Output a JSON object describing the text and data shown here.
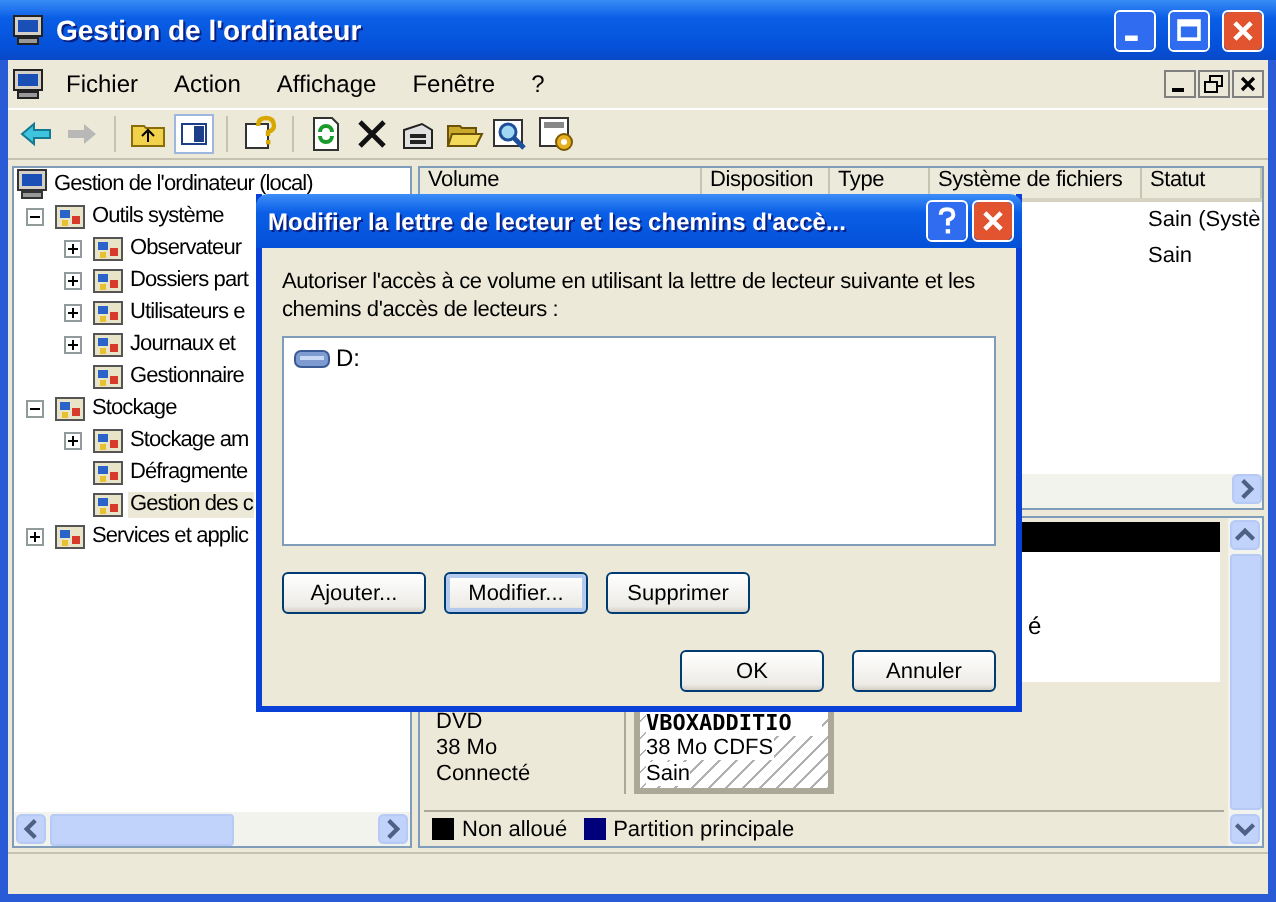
{
  "window": {
    "title": "Gestion de l'ordinateur"
  },
  "menu": [
    "Fichier",
    "Action",
    "Affichage",
    "Fenêtre",
    "?"
  ],
  "tree": {
    "label": "Gestion de l'ordinateur (local)",
    "selected": false,
    "children": [
      {
        "label": "Outils système",
        "expanded": true,
        "selected": false,
        "children": [
          {
            "label": "Observateur",
            "expanded": false,
            "selected": false
          },
          {
            "label": "Dossiers part",
            "expanded": false,
            "selected": false
          },
          {
            "label": "Utilisateurs e",
            "expanded": false,
            "selected": false
          },
          {
            "label": "Journaux et",
            "expanded": false,
            "selected": false
          },
          {
            "label": "Gestionnaire",
            "selected": false
          }
        ]
      },
      {
        "label": "Stockage",
        "expanded": true,
        "selected": false,
        "children": [
          {
            "label": "Stockage am",
            "expanded": false,
            "selected": false
          },
          {
            "label": "Défragmente",
            "selected": false
          },
          {
            "label": "Gestion des c",
            "selected": true
          }
        ]
      },
      {
        "label": "Services et applic",
        "expanded": false,
        "selected": false
      }
    ]
  },
  "volume_list": {
    "columns": [
      "Volume",
      "Disposition",
      "Type",
      "Système de fichiers",
      "Statut"
    ],
    "rows": [
      {
        "statut": "Sain (Systè"
      },
      {
        "statut": "Sain"
      }
    ]
  },
  "disk_view": {
    "disk_0": {
      "volume_text": "é"
    },
    "disk_1": {
      "labels": [
        "DVD",
        "38 Mo",
        "Connecté"
      ],
      "volume_name": "VBOXADDITIO",
      "volume_details": [
        "38 Mo CDFS",
        "Sain"
      ]
    },
    "legend": [
      {
        "label": "Non alloué",
        "color": "#000000"
      },
      {
        "label": "Partition principale",
        "color": "#00007b"
      }
    ]
  },
  "dialog": {
    "title": "Modifier la lettre de lecteur et les chemins d'accè...",
    "text": "Autoriser l'accès à ce volume en utilisant la lettre de lecteur suivante et les chemins d'accès de lecteurs :",
    "paths": [
      {
        "label": "D:",
        "selected": false
      }
    ],
    "buttons": [
      {
        "label": "Ajouter...",
        "focused": false
      },
      {
        "label": "Modifier...",
        "focused": true
      },
      {
        "label": "Supprimer",
        "focused": false
      }
    ],
    "footer_buttons": [
      {
        "label": "OK",
        "focused": false
      },
      {
        "label": "Annuler",
        "focused": false
      }
    ]
  }
}
